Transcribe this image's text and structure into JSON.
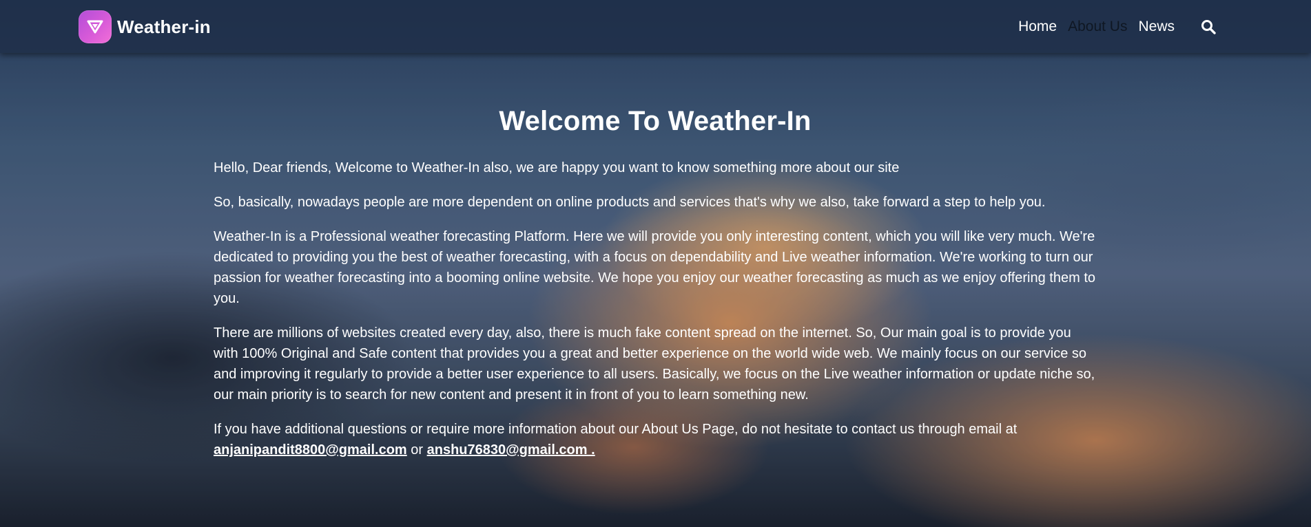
{
  "brand": {
    "name": "Weather-in",
    "logo_icon": "triangle-logo-icon",
    "logo_colors": [
      "#b24ed8",
      "#f26fd7"
    ]
  },
  "nav": {
    "items": [
      {
        "label": "Home",
        "active": false
      },
      {
        "label": "About Us",
        "active": true
      },
      {
        "label": "News",
        "active": false
      }
    ],
    "search_icon": "search-icon"
  },
  "main": {
    "title": "Welcome To Weather-In",
    "paragraphs": [
      "Hello, Dear friends, Welcome to Weather-In also, we are happy you want to know something more about our site",
      "So, basically, nowadays people are more dependent on online products and services that's why we also, take forward a step to help you.",
      "Weather-In is a Professional weather forecasting Platform. Here we will provide you only interesting content, which you will like very much. We're dedicated to providing you the best of weather forecasting, with a focus on dependability and Live weather information. We're working to turn our passion for weather forecasting into a booming online website. We hope you enjoy our weather forecasting as much as we enjoy offering them to you.",
      "There are millions of websites created every day, also, there is much fake content spread on the internet. So, Our main goal is to provide you with 100% Original and Safe content that provides you a great and better experience on the world wide web. We mainly focus on our service so and improving it regularly to provide a better user experience to all users. Basically, we focus on the Live weather information or update niche so, our main priority is to search for new content and present it in front of you to learn something new."
    ],
    "contact": {
      "text": "If you have additional questions or require more information about our About Us Page, do not hesitate to contact us through email at",
      "email_1": "anjanipandit8800@gmail.com",
      "separator": "or",
      "email_2": "anshu76830@gmail.com ."
    }
  },
  "colors": {
    "navbar_bg": "#1e2d46",
    "active_nav": "#0f1723",
    "text": "#ffffff"
  }
}
